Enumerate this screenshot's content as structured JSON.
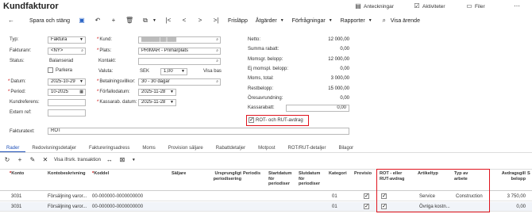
{
  "app": {
    "title": "Kundfakturor"
  },
  "topright": {
    "notes": "Anteckningar",
    "activities": "Aktiviteter",
    "files": "Filer"
  },
  "toolbar": {
    "save_close": "Spara och stäng",
    "release": "Frisläpp",
    "actions": "Åtgärder",
    "queries": "Förfrågningar",
    "reports": "Rapporter",
    "show_case": "Visa ärende"
  },
  "form": {
    "typ_label": "Typ:",
    "typ_value": "Faktura",
    "fakturanr_label": "Fakturanr:",
    "fakturanr_value": "<NY>",
    "status_label": "Status:",
    "status_value": "Balanserad",
    "parkera_label": "Parkera",
    "datum_label": "Datum:",
    "datum_value": "2025-10-29",
    "period_label": "Period:",
    "period_value": "10-2025",
    "kundref_label": "Kundreferens:",
    "externref_label": "Extern ref:",
    "kund_label": "Kund:",
    "kund_value": "██████ ██ ███",
    "plats_label": "Plats:",
    "plats_value": "PRIMÄR - Primärplats",
    "kontakt_label": "Kontakt:",
    "valuta_label": "Valuta:",
    "valuta_code": "SEK",
    "valuta_rate": "1,00",
    "valuta_view": "Visa bas",
    "betvillkor_label": "Betalningsvillkor:",
    "betvillkor_value": "30 - 30 dagar",
    "forfallo_label": "Förfallodatum:",
    "forfallo_value": "2025-11-28",
    "kassarab_label": "Kassarab. datum:",
    "kassarab_value": "2025-11-28",
    "fakturatext_label": "Fakturatext:",
    "fakturatext_value": "ROT"
  },
  "totals": [
    {
      "label": "Netto:",
      "value": "12 000,00"
    },
    {
      "label": "Summa rabatt:",
      "value": "0,00"
    },
    {
      "label": "Momsgr. belopp:",
      "value": "12 000,00"
    },
    {
      "label": "Ej momspl. belopp:",
      "value": "0,00"
    },
    {
      "label": "Moms, total:",
      "value": "3 000,00"
    },
    {
      "label": "Restbelopp:",
      "value": "15 000,00"
    },
    {
      "label": "Öresavrundning:",
      "value": "0,00"
    },
    {
      "label": "Kassarabatt:",
      "value": "0,00"
    }
  ],
  "rot_rut_checkbox": {
    "label": "ROT- och RUT-avdrag",
    "checked": true
  },
  "tabs": [
    "Rader",
    "Redovisningsdetaljer",
    "Faktureringsadress",
    "Moms",
    "Provision säljare",
    "Rabattdetaljer",
    "Motpost",
    "ROT/RUT-detaljer",
    "Bilagor"
  ],
  "grid_toolbar": {
    "show_trans": "Visa ifrsrk. transaktion"
  },
  "columns": {
    "konto": "Konto",
    "kontobeskr": "Kontobeskrivning",
    "koddel": "Koddel",
    "saljare": "Säljare",
    "ursp": "Ursprungligt periodisering",
    "period": "Periodis",
    "startdatum": "Startdatum för periodiser",
    "slutdatum": "Slutdatum för periodiser",
    "kategori": "Kategori",
    "provision": "Provisio",
    "rotrut": "ROT - eller RUT-avdrag",
    "artikeltyp": "Artikeltyp",
    "typarbete": "Typ av arbete",
    "belopp": "Avdragsgill belopp",
    "s": "S"
  },
  "rows": [
    {
      "konto": "3031",
      "kontobeskr": "Försäljning varor...",
      "koddel": "00-000000-0000000000",
      "kategori": "01",
      "provision": true,
      "rotrut": true,
      "artikeltyp": "Service",
      "typarbete": "Construction",
      "belopp": "3 750,00"
    },
    {
      "konto": "3031",
      "kontobeskr": "Försäljning varor...",
      "koddel": "00-000000-0000000000",
      "kategori": "01",
      "provision": true,
      "rotrut": true,
      "artikeltyp": "Övriga kostn...",
      "typarbete": "",
      "belopp": "0,00"
    }
  ],
  "colors": {
    "accent": "#1d4fb8",
    "highlight": "#e0141e"
  }
}
